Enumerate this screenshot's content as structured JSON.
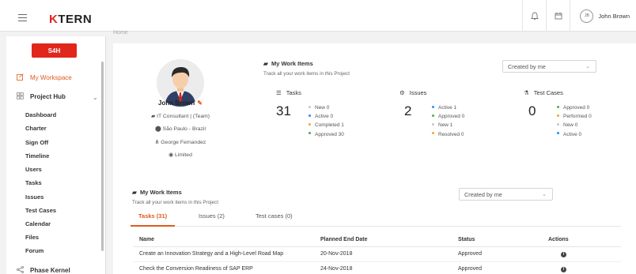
{
  "app": {
    "logo_mark": "K",
    "logo_text": "TERN",
    "breadcrumb_ghost": "Home",
    "user": {
      "initials": "JB",
      "name": "John Brown"
    },
    "accent": "#e05a1f",
    "brand_red": "#e1261c"
  },
  "sidebar": {
    "badge": "S4H",
    "workspace": {
      "label": "My Workspace",
      "icon": "workspace-icon"
    },
    "project_hub": {
      "label": "Project Hub",
      "icon": "grid-icon"
    },
    "items": [
      "Dashboard",
      "Charter",
      "Sign Off",
      "Timeline",
      "Users",
      "Tasks",
      "Issues",
      "Test Cases",
      "Calendar",
      "Files",
      "Forum"
    ],
    "phase_kernel": {
      "label": "Phase Kernel",
      "icon": "share-icon"
    }
  },
  "profile": {
    "name": "John Brown",
    "role": "IT Consultant | (Team)",
    "location": "São Paulo - Brazil",
    "manager": "George Fernandez",
    "access": "Limited"
  },
  "summary": {
    "title": "My Work Items",
    "subtitle": "Track all your work items in this Project",
    "filter": "Created by me",
    "tasks": {
      "label": "Tasks",
      "total": "31",
      "rows": [
        {
          "text": "New 0",
          "color": "#c8c8c8"
        },
        {
          "text": "Active 0",
          "color": "#2b8cf0"
        },
        {
          "text": "Completed 1",
          "color": "#f5a623"
        },
        {
          "text": "Approved 30",
          "color": "#4caf50"
        }
      ]
    },
    "issues": {
      "label": "Issues",
      "total": "2",
      "rows": [
        {
          "text": "Active 1",
          "color": "#2b8cf0"
        },
        {
          "text": "Approved 0",
          "color": "#4caf50"
        },
        {
          "text": "New 1",
          "color": "#c8c8c8"
        },
        {
          "text": "Resolved 0",
          "color": "#f5a623"
        }
      ]
    },
    "testcases": {
      "label": "Test Cases",
      "total": "0",
      "rows": [
        {
          "text": "Approved 0",
          "color": "#4caf50"
        },
        {
          "text": "Performed 0",
          "color": "#f5a623"
        },
        {
          "text": "New 0",
          "color": "#c8c8c8"
        },
        {
          "text": "Active 0",
          "color": "#2b8cf0"
        }
      ]
    }
  },
  "list": {
    "title": "My Work Items",
    "subtitle": "Track all your work items in this Project",
    "filter": "Created by me",
    "tabs": [
      "Tasks (31)",
      "Issues (2)",
      "Test cases (0)"
    ],
    "columns": [
      "Name",
      "Planned End Date",
      "Status",
      "Actions"
    ],
    "rows": [
      {
        "name": "Create an Innovation Strategy and a High-Level Road Map",
        "date": "20-Nov-2018",
        "status": "Approved"
      },
      {
        "name": "Check the Conversion Readiness of SAP ERP",
        "date": "24-Nov-2018",
        "status": "Approved"
      }
    ]
  }
}
